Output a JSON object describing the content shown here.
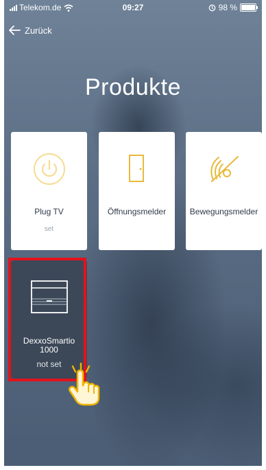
{
  "status_bar": {
    "carrier": "Telekom.de",
    "time": "09:27",
    "battery": "98 %"
  },
  "nav": {
    "back_label": "Zurück"
  },
  "page": {
    "title": "Produkte"
  },
  "products": [
    {
      "name": "Plug TV",
      "state": "set",
      "icon": "power-icon"
    },
    {
      "name": "Öffnungsmelder",
      "state": "",
      "icon": "door-icon"
    },
    {
      "name": "Bewegungsmelder",
      "state": "",
      "icon": "motion-sensor-icon"
    },
    {
      "name": "DexxoSmartio 1000",
      "state": "not set",
      "icon": "gate-motor-icon",
      "highlighted": true
    }
  ],
  "colors": {
    "accent": "#f2c84b",
    "highlight": "#e3121b",
    "tile_dark": "#3c4858"
  }
}
